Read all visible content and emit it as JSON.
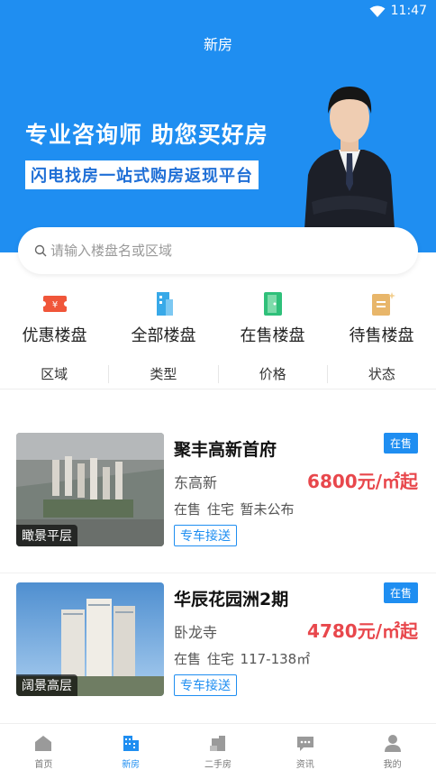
{
  "status_bar": {
    "time": "11:47"
  },
  "header": {
    "title": "新房"
  },
  "banner": {
    "headline": "专业咨询师 助您买好房",
    "subline": "闪电找房一站式购房返现平台"
  },
  "search": {
    "placeholder": "请输入楼盘名或区域"
  },
  "categories": [
    {
      "label": "优惠楼盘",
      "icon": "coupon-icon",
      "color": "#f0563a"
    },
    {
      "label": "全部楼盘",
      "icon": "building-icon",
      "color": "#38a9e8"
    },
    {
      "label": "在售楼盘",
      "icon": "door-icon",
      "color": "#2fc07a"
    },
    {
      "label": "待售楼盘",
      "icon": "calendar-icon",
      "color": "#e8b66a"
    }
  ],
  "filters": [
    "区域",
    "类型",
    "价格",
    "状态"
  ],
  "listings": [
    {
      "name": "聚丰高新首府",
      "badge": "在售",
      "district": "东高新",
      "price": "6800元/㎡起",
      "meta": "在售  住宅  暂未公布",
      "tag": "专车接送",
      "image_caption": "瞰景平层"
    },
    {
      "name": "华辰花园洲2期",
      "badge": "在售",
      "district": "卧龙寺",
      "price": "4780元/㎡起",
      "meta": "在售  住宅  117-138㎡",
      "tag": "专车接送",
      "image_caption": "阔景高层"
    }
  ],
  "bottom_nav": [
    {
      "label": "首页",
      "icon": "home-icon",
      "active": false
    },
    {
      "label": "新房",
      "icon": "new-house-icon",
      "active": true
    },
    {
      "label": "二手房",
      "icon": "second-hand-icon",
      "active": false
    },
    {
      "label": "资讯",
      "icon": "news-icon",
      "active": false
    },
    {
      "label": "我的",
      "icon": "profile-icon",
      "active": false
    }
  ],
  "colors": {
    "primary": "#1f8ef1",
    "price": "#e8474c"
  }
}
